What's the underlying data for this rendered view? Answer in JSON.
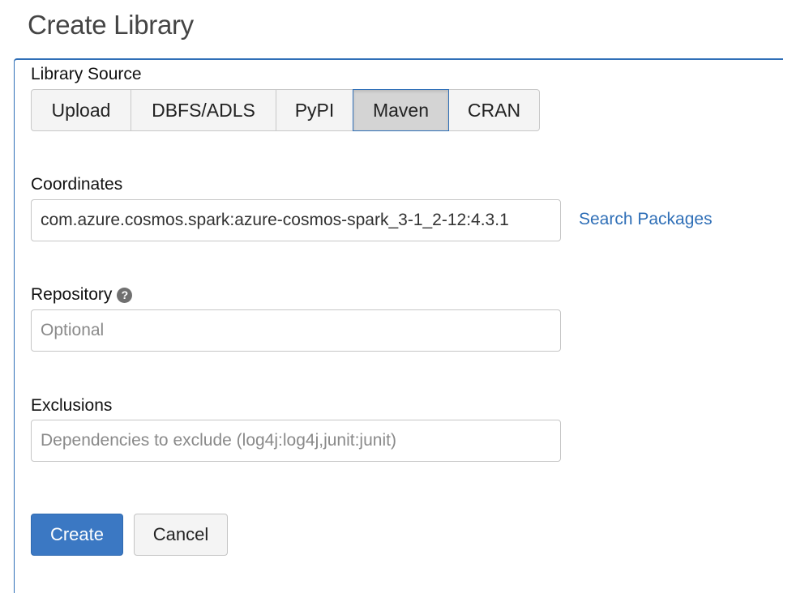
{
  "page": {
    "title": "Create Library"
  },
  "library_source": {
    "label": "Library Source",
    "options": [
      "Upload",
      "DBFS/ADLS",
      "PyPI",
      "Maven",
      "CRAN"
    ],
    "selected": "Maven"
  },
  "coordinates": {
    "label": "Coordinates",
    "value": "com.azure.cosmos.spark:azure-cosmos-spark_3-1_2-12:4.3.1",
    "search_link": "Search Packages"
  },
  "repository": {
    "label": "Repository",
    "placeholder": "Optional",
    "help_icon": "question-circle-icon"
  },
  "exclusions": {
    "label": "Exclusions",
    "placeholder": "Dependencies to exclude (log4j:log4j,junit:junit)"
  },
  "actions": {
    "create_label": "Create",
    "cancel_label": "Cancel"
  },
  "colors": {
    "accent": "#2f6fb7",
    "primary_button": "#3b78c3",
    "selected_segment": "#d4d4d4"
  }
}
